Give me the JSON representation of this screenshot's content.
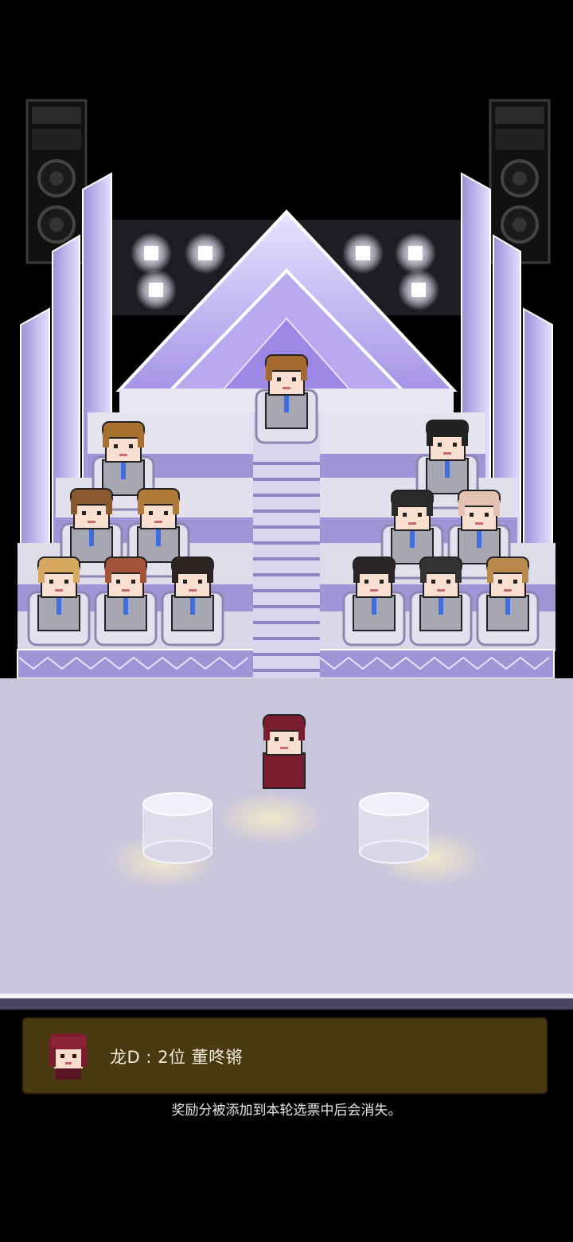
{
  "dialog": {
    "speaker": "龙D",
    "message": "龙D : 2位 董咚锵"
  },
  "hint_text": "奖励分被添加到本轮选票中后会消失。",
  "colors": {
    "background": "#000000",
    "stage_floor": "#c9c5dc",
    "stage_purple": "#a79ce0",
    "dialog_bg": "#4a3a12",
    "dialog_text": "#f0ead8",
    "uniform": "#a7a7b4",
    "tie": "#3f6ee0",
    "player_outfit": "#7a1d2e"
  },
  "scene": {
    "description_icons": [
      "speaker-icon",
      "spotlight-icon",
      "pyramid-stage-icon",
      "podium-icon"
    ],
    "top_trainee_hair": "#a5682e",
    "trainee_hairs": [
      "#a8702f",
      "#8a5a2e",
      "#b07a38",
      "#d6a860",
      "#a5523a",
      "#2b2420",
      "#222222",
      "#2a2a2a",
      "#e4c0b0",
      "#2b2525",
      "#333333",
      "#b98a4e"
    ],
    "player_hair": "#7a1d2e"
  }
}
